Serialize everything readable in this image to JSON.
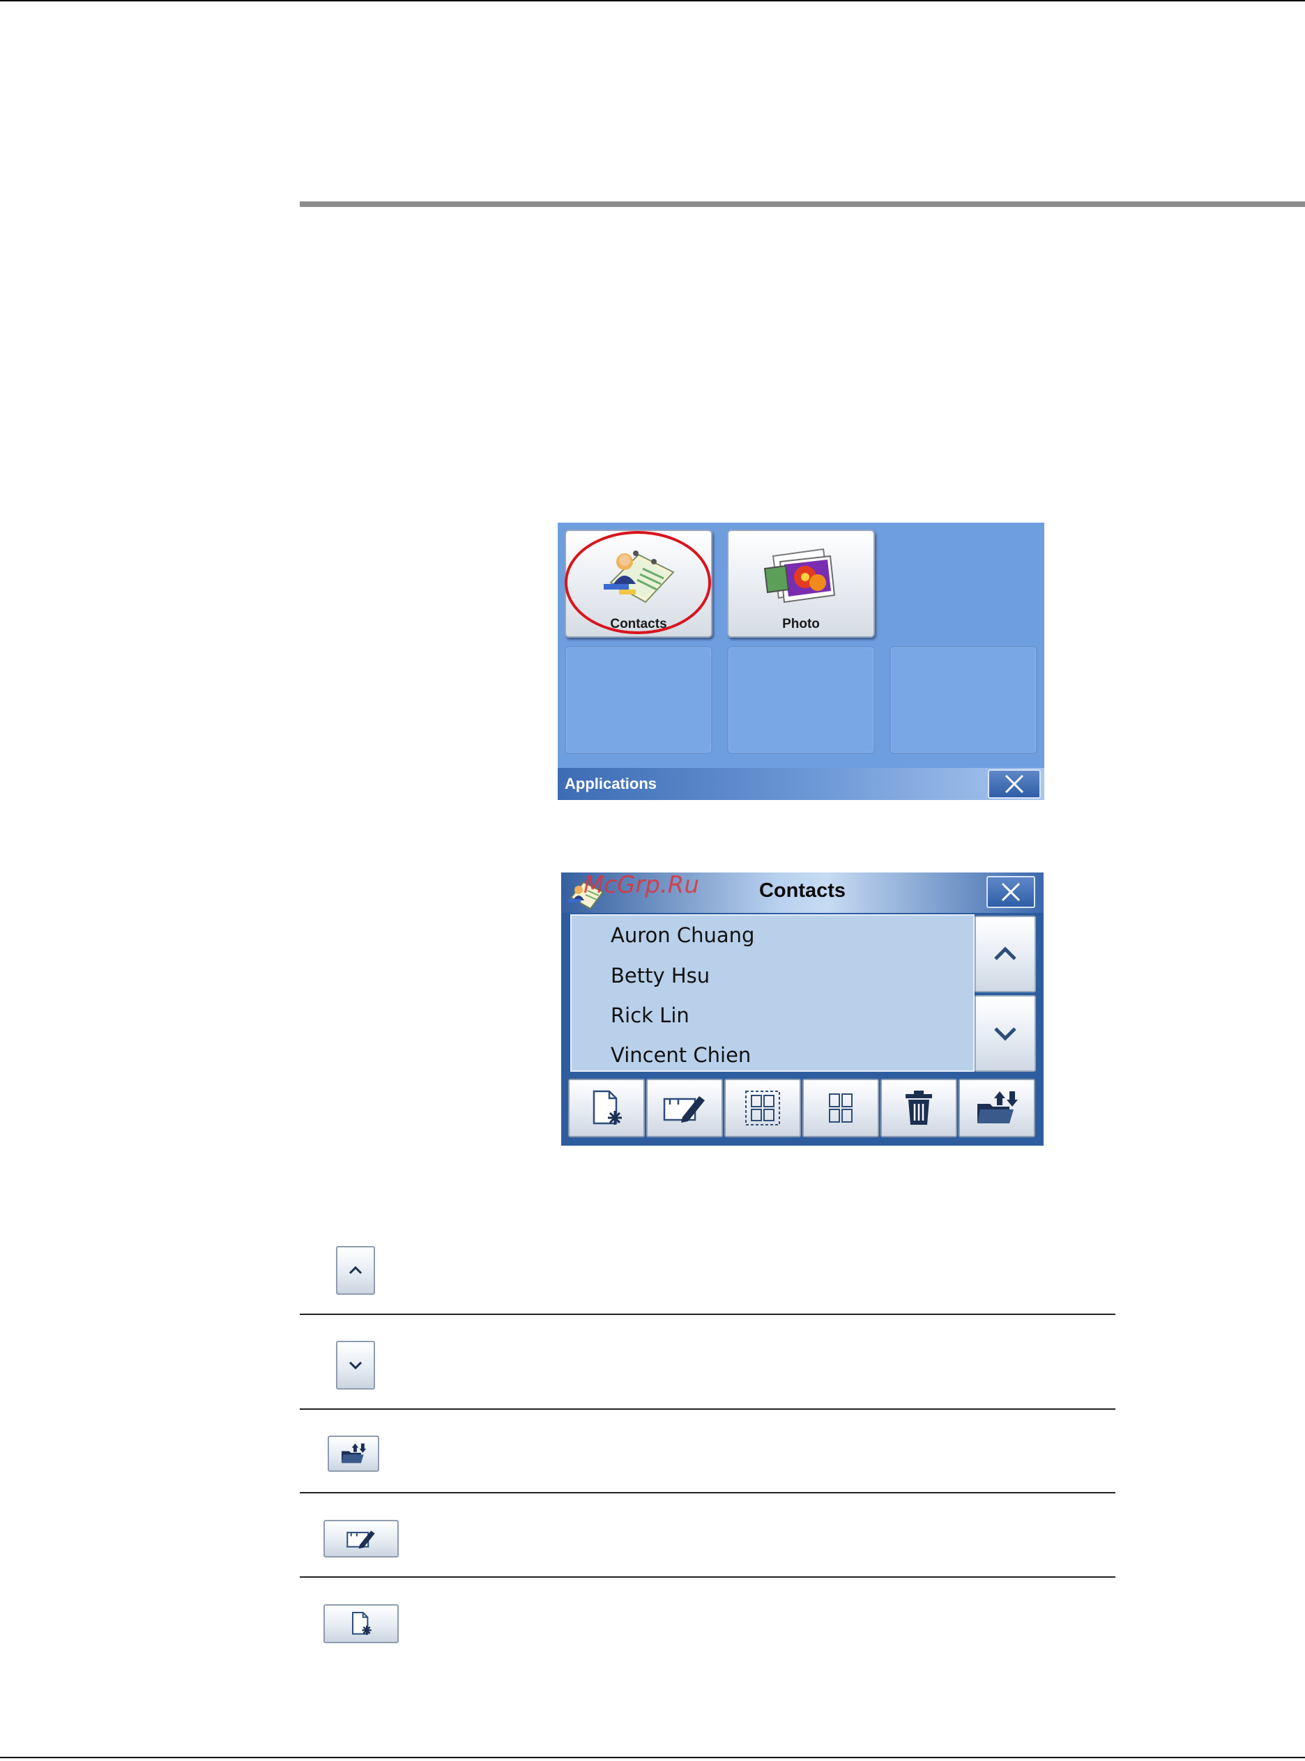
{
  "applications_screen": {
    "title": "Applications",
    "tiles": [
      {
        "label": "Contacts",
        "icon": "contacts-card-icon"
      },
      {
        "label": "Photo",
        "icon": "photo-stack-icon"
      }
    ],
    "highlight": "red circle around Contacts tile"
  },
  "contacts_screen": {
    "title": "Contacts",
    "watermark": "McGrp.Ru",
    "entries": [
      "Auron Chuang",
      "Betty Hsu",
      "Rick Lin",
      "Vincent Chien"
    ],
    "toolbar_icons": [
      "new-contact-icon",
      "edit-contact-icon",
      "select-all-icon",
      "unselect-icon",
      "trash-icon",
      "import-export-icon"
    ]
  },
  "colors": {
    "screen_blue": "#6f9edf",
    "dark_blue": "#2d5d9f",
    "list_bg": "#b9d0ea",
    "highlight_red": "#d8141e",
    "watermark_red": "#e0333a"
  },
  "legend_rows": [
    {
      "icon": "scroll-up-icon"
    },
    {
      "icon": "scroll-down-icon"
    },
    {
      "icon": "import-export-icon"
    },
    {
      "icon": "edit-contact-icon"
    },
    {
      "icon": "new-contact-icon"
    }
  ]
}
